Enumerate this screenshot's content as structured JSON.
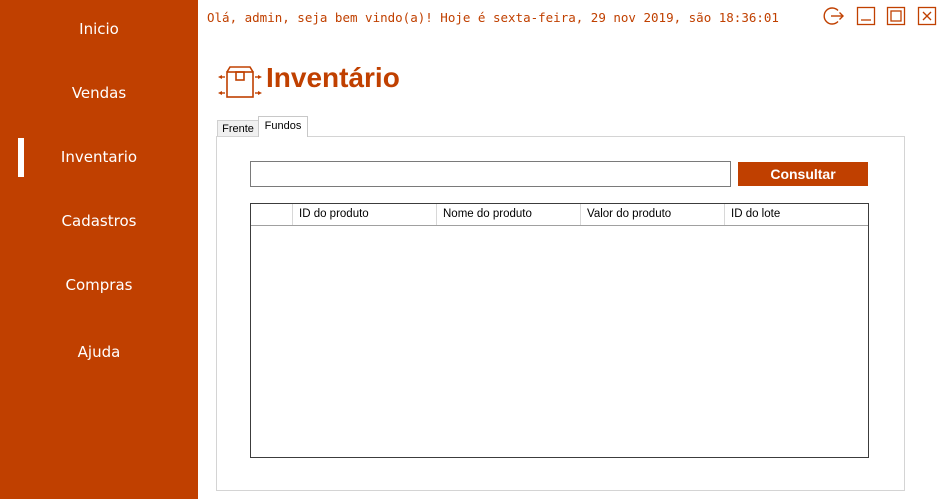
{
  "sidebar": {
    "items": [
      {
        "label": "Inicio"
      },
      {
        "label": "Vendas"
      },
      {
        "label": "Inventario"
      },
      {
        "label": "Cadastros"
      },
      {
        "label": "Compras"
      },
      {
        "label": "Ajuda"
      }
    ],
    "active": "Inventario",
    "color": "#C04000"
  },
  "header": {
    "greeting": "Olá, admin, seja bem vindo(a)! Hoje é sexta-feira, 29 nov 2019, são 18:36:01",
    "window_buttons": [
      "logout-icon",
      "minimize-icon",
      "maximize-icon",
      "close-icon"
    ]
  },
  "page": {
    "title": "Inventário",
    "icon": "box-icon"
  },
  "tabs": [
    {
      "label": "Frente",
      "selected": false
    },
    {
      "label": "Fundos",
      "selected": true
    }
  ],
  "search": {
    "value": "",
    "button_label": "Consultar"
  },
  "table": {
    "columns": [
      "",
      "ID do produto",
      "Nome do produto",
      "Valor do produto",
      "ID do lote"
    ],
    "rows": []
  }
}
